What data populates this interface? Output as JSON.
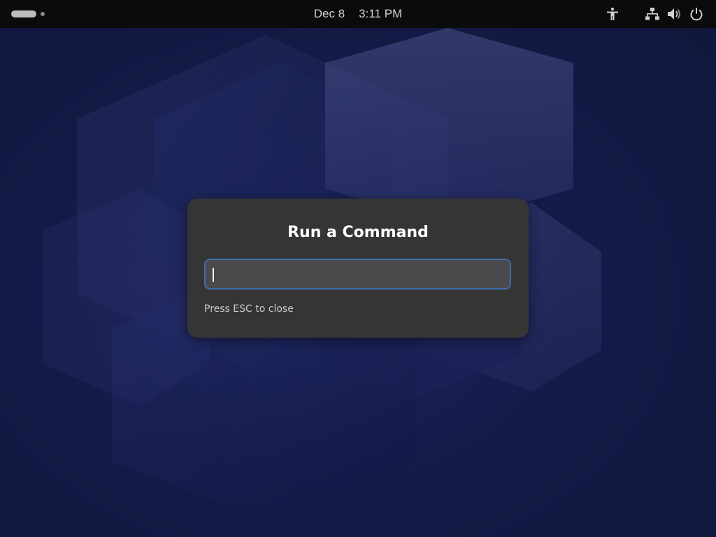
{
  "topbar": {
    "date": "Dec 8",
    "time": "3:11 PM",
    "icons": {
      "accessibility": "accessibility-icon",
      "network": "network-wired-icon",
      "volume": "volume-icon",
      "power": "power-icon"
    }
  },
  "dialog": {
    "title": "Run a Command",
    "input_value": "",
    "hint": "Press ESC to close"
  },
  "colors": {
    "topbar": "#0b0b0d",
    "dialog_bg": "#353535",
    "entry_focus_border": "#3f6ea8",
    "wallpaper_base": "#151b49"
  }
}
